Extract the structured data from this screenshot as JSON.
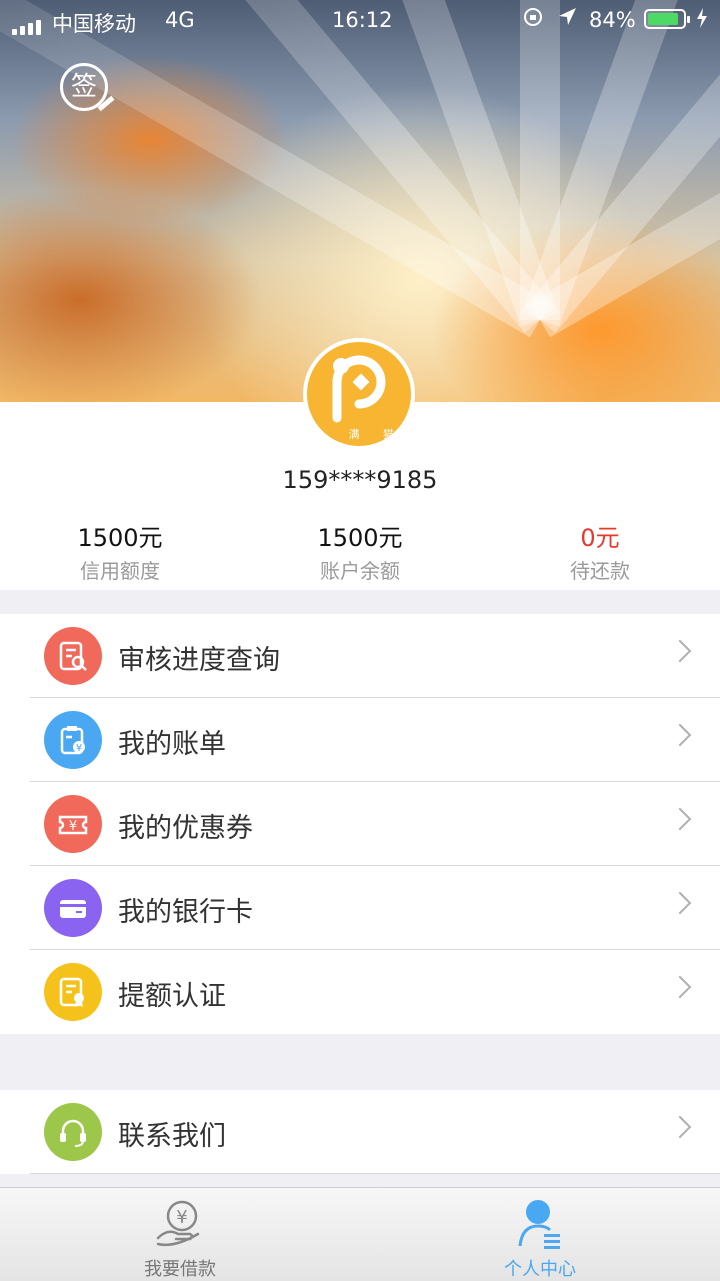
{
  "status_bar": {
    "carrier": "中国移动",
    "network": "4G",
    "time": "16:12",
    "battery": "84%"
  },
  "header": {
    "sign_label": "签",
    "avatar_brand": "小 满 猫"
  },
  "user": {
    "phone": "159****9185"
  },
  "stats": [
    {
      "value": "1500元",
      "label": "信用额度",
      "color": "#111111"
    },
    {
      "value": "1500元",
      "label": "账户余额",
      "color": "#111111"
    },
    {
      "value": "0元",
      "label": "待还款",
      "color": "#e8382a"
    }
  ],
  "menu": [
    {
      "label": "审核进度查询",
      "icon": "review-search-icon",
      "color": "#f1695b"
    },
    {
      "label": "我的账单",
      "icon": "bill-icon",
      "color": "#4aa8f2"
    },
    {
      "label": "我的优惠券",
      "icon": "coupon-icon",
      "color": "#f1695b"
    },
    {
      "label": "我的银行卡",
      "icon": "bank-card-icon",
      "color": "#8a63f0"
    },
    {
      "label": "提额认证",
      "icon": "certification-icon",
      "color": "#f5c21b"
    }
  ],
  "menu2": [
    {
      "label": "联系我们",
      "icon": "headset-icon",
      "color": "#9dc74a"
    }
  ],
  "tabbar": [
    {
      "label": "我要借款",
      "icon": "loan-icon",
      "active": false
    },
    {
      "label": "个人中心",
      "icon": "profile-icon",
      "active": true
    }
  ],
  "colors": {
    "accent": "#4aa8f2",
    "tab_inactive": "#777777"
  }
}
